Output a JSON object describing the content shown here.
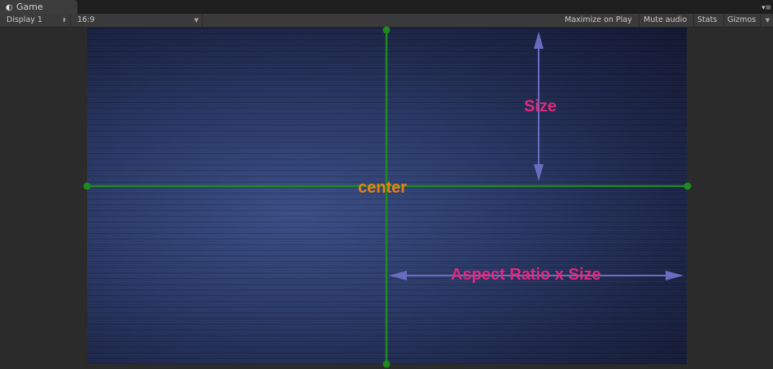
{
  "tab": {
    "icon": "unity-logo-icon",
    "title": "Game",
    "menu_icon": "tab-menu-icon"
  },
  "toolbar": {
    "display": "Display 1",
    "aspect": "16:9",
    "maximize": "Maximize on Play",
    "mute": "Mute audio",
    "stats": "Stats",
    "gizmos": "Gizmos"
  },
  "annotations": {
    "center": "center",
    "size": "Size",
    "aspect_size": "Aspect Ratio x Size"
  },
  "colors": {
    "guide_line": "#1e8a1e",
    "arrow": "#6a6cc0",
    "center_label": "#e8801a",
    "size_label": "#e0297e"
  }
}
